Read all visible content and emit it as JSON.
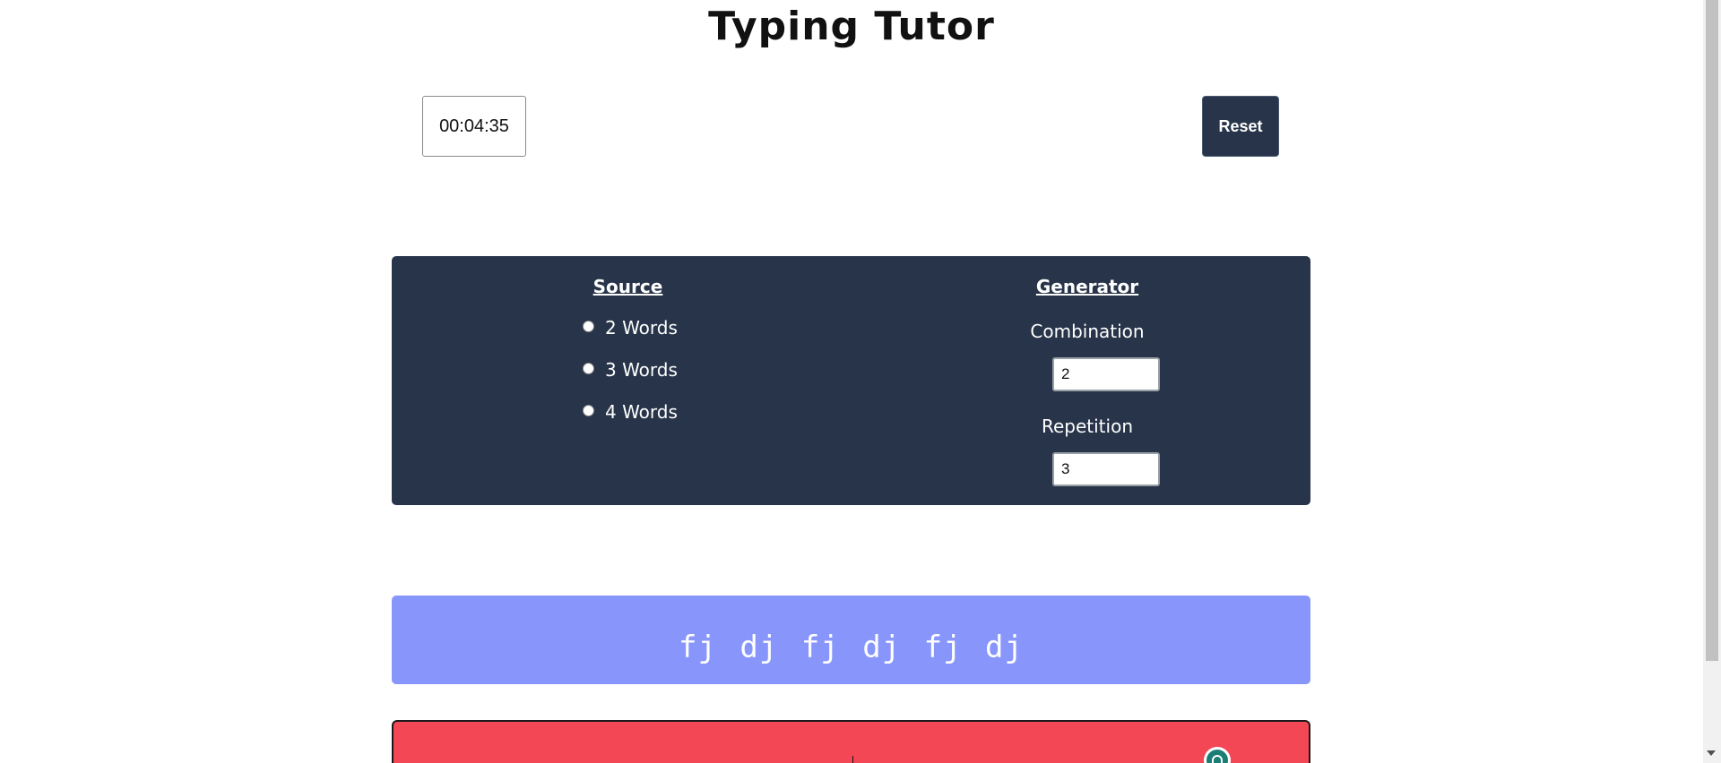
{
  "header": {
    "title": "Typing Tutor"
  },
  "controls": {
    "timer": "00:04:35",
    "reset_label": "Reset"
  },
  "settings": {
    "source": {
      "heading": "Source",
      "options": [
        {
          "label": "2 Words",
          "checked": false
        },
        {
          "label": "3 Words",
          "checked": false
        },
        {
          "label": "4 Words",
          "checked": false
        }
      ]
    },
    "generator": {
      "heading": "Generator",
      "combination_label": "Combination",
      "combination_value": "2",
      "repetition_label": "Repetition",
      "repetition_value": "3"
    }
  },
  "practice": {
    "text": "fj dj fj dj fj dj"
  },
  "colors": {
    "panel": "#273449",
    "display": "#8896fc",
    "typing_area": "#f44756"
  },
  "icons": {
    "extension": "grammar-extension-icon"
  }
}
